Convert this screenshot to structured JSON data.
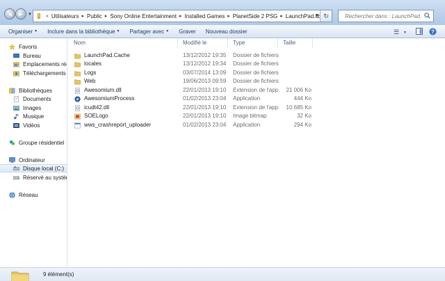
{
  "address": {
    "prefix": "«",
    "crumbs": [
      "Utilisateurs",
      "Public",
      "Sony Online Entertainment",
      "Installed Games",
      "PlanetSide 2 PSG",
      "LaunchPad.libs"
    ]
  },
  "search": {
    "placeholder": "Rechercher dans : LaunchPad.libs"
  },
  "toolbar": {
    "organize": "Organiser",
    "include": "Inclure dans la bibliothèque",
    "share": "Partager avec",
    "burn": "Graver",
    "new_folder": "Nouveau dossier"
  },
  "nav": {
    "favorites": "Favoris",
    "desktop": "Bureau",
    "recent": "Emplacements récents",
    "downloads": "Téléchargements",
    "libraries": "Bibliothèques",
    "documents": "Documents",
    "pictures": "Images",
    "music": "Musique",
    "videos": "Vidéos",
    "homegroup": "Groupe résidentiel",
    "computer": "Ordinateur",
    "local_disk": "Disque local (C:)",
    "reserved": "Réservé au système",
    "network": "Réseau"
  },
  "columns": {
    "name": "Nom",
    "modified": "Modifié le",
    "type": "Type",
    "size": "Taille"
  },
  "files": [
    {
      "name": "LaunchPad.Cache",
      "date": "13/12/2012 19:35",
      "type": "Dossier de fichiers",
      "size": "",
      "icon": "folder-icon"
    },
    {
      "name": "locales",
      "date": "13/12/2012 19:34",
      "type": "Dossier de fichiers",
      "size": "",
      "icon": "folder-icon"
    },
    {
      "name": "Logs",
      "date": "03/07/2014 13:09",
      "type": "Dossier de fichiers",
      "size": "",
      "icon": "folder-icon"
    },
    {
      "name": "Web",
      "date": "19/06/2013 09:59",
      "type": "Dossier de fichiers",
      "size": "",
      "icon": "folder-icon"
    },
    {
      "name": "Awesomium.dll",
      "date": "22/01/2013 19:10",
      "type": "Extension de l'app...",
      "size": "21 006 Ko",
      "icon": "dll-icon"
    },
    {
      "name": "AwesomiumProcess",
      "date": "01/02/2013 23:04",
      "type": "Application",
      "size": "444 Ko",
      "icon": "app-icon"
    },
    {
      "name": "icudt42.dll",
      "date": "22/01/2013 19:10",
      "type": "Extension de l'app...",
      "size": "10 685 Ko",
      "icon": "dll-icon"
    },
    {
      "name": "SOELogo",
      "date": "22/01/2013 19:10",
      "type": "Image bitmap",
      "size": "32 Ko",
      "icon": "bitmap-icon"
    },
    {
      "name": "wws_crashreport_uploader",
      "date": "01/02/2013 23:04",
      "type": "Application",
      "size": "294 Ko",
      "icon": "exe-icon"
    }
  ],
  "status": {
    "count": "9 élément(s)"
  }
}
